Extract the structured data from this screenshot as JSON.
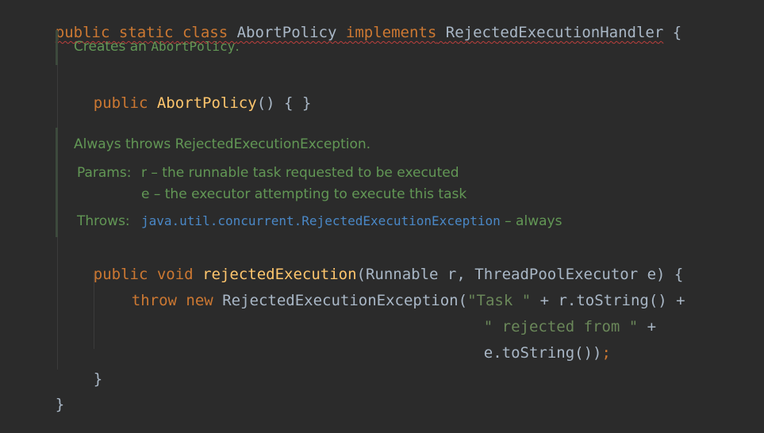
{
  "class_decl": {
    "kw_public": "public",
    "kw_static": "static",
    "kw_class": "class",
    "class_name": "AbortPolicy",
    "kw_implements": "implements",
    "iface": "RejectedExecutionHandler",
    "brace": "{"
  },
  "doc1": {
    "text_prefix": "Creates an ",
    "code": "AbortPolicy",
    "text_suffix": "."
  },
  "ctor": {
    "kw_public": "public",
    "name": "AbortPolicy",
    "rest": "() { }"
  },
  "doc2": {
    "summary": "Always throws RejectedExecutionException.",
    "params_label": "Params:",
    "param1": "r – the runnable task requested to be executed",
    "param2": "e – the executor attempting to execute this task",
    "throws_label": "Throws:",
    "throws_link": "java.util.concurrent.RejectedExecutionException",
    "throws_desc": " – always"
  },
  "method": {
    "kw_public": "public",
    "kw_void": "void",
    "name": "rejectedExecution",
    "params": "(Runnable r, ThreadPoolExecutor e) {"
  },
  "throw_stmt": {
    "kw_throw": "throw",
    "kw_new": "new",
    "ex_call": "RejectedExecutionException(",
    "str1": "\"Task \"",
    "rest1": " + r.toString() +",
    "str2": "\" rejected from \"",
    "rest2": " +",
    "last": "e.toString())",
    "semicolon": ";"
  },
  "close_method": "}",
  "close_class": "}"
}
